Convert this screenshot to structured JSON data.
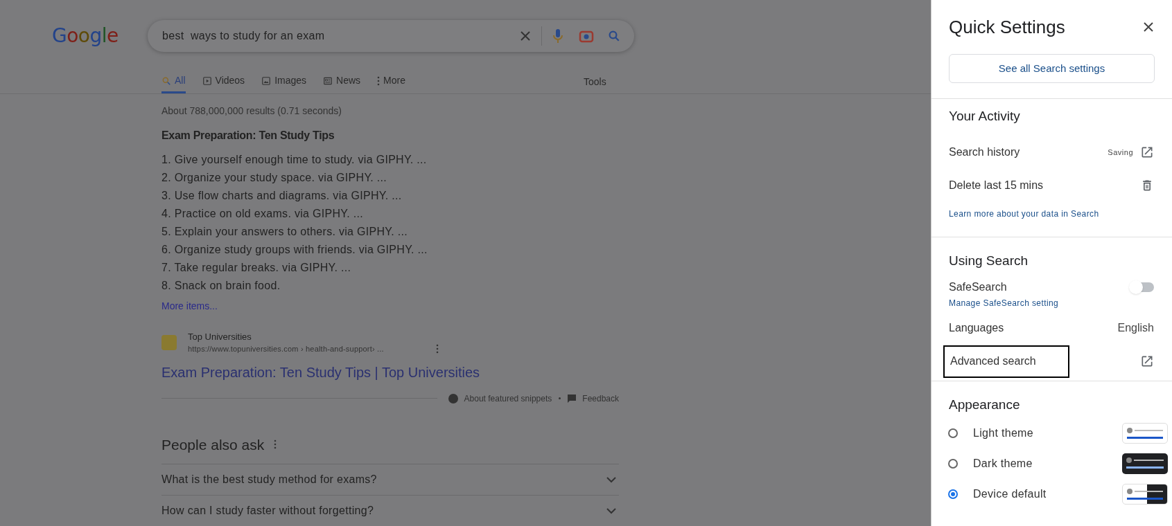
{
  "search_page": {
    "logo": "Google",
    "query": "best  ways to study for an exam",
    "tabs": [
      {
        "label": "All",
        "kind": "search",
        "selected": true
      },
      {
        "label": "Videos",
        "kind": "video",
        "selected": false
      },
      {
        "label": "Images",
        "kind": "image",
        "selected": false
      },
      {
        "label": "News",
        "kind": "news",
        "selected": false
      },
      {
        "label": "More",
        "kind": "dots",
        "selected": false
      }
    ],
    "tools": "Tools",
    "result_stats": "About 788,000,000 results (0.71 seconds)",
    "snippet_title": "Exam Preparation: Ten Study Tips",
    "snippet_items": [
      "1. Give yourself enough time to study. via GIPHY. ...",
      "2. Organize your study space. via GIPHY. ...",
      "3. Use flow charts and diagrams. via GIPHY. ...",
      "4. Practice on old exams. via GIPHY. ...",
      "5. Explain your answers to others. via GIPHY. ...",
      "6. Organize study groups with friends. via GIPHY. ...",
      "7. Take regular breaks. via GIPHY. ...",
      "8. Snack on brain food."
    ],
    "more_items": "More items...",
    "source_name": "Top Universities",
    "source_url": "https://www.topuniversities.com › health-and-support› ...",
    "result_title": "Exam Preparation: Ten Study Tips | Top Universities",
    "about_snippets": "About featured snippets",
    "feedback": "Feedback",
    "people_also_ask": "People also ask",
    "questions": [
      "What is the best study method for exams?",
      "How can I study faster without forgetting?"
    ]
  },
  "quick_settings": {
    "title": "Quick Settings",
    "see_all": "See all Search settings",
    "activity": {
      "heading": "Your Activity",
      "search_history": "Search history",
      "saving": "Saving",
      "delete_last": "Delete last 15 mins",
      "learn_more": "Learn more about your data in Search"
    },
    "using_search": {
      "heading": "Using Search",
      "safesearch": "SafeSearch",
      "safesearch_on": false,
      "manage_safesearch": "Manage SafeSearch setting",
      "languages": "Languages",
      "language_value": "English",
      "advanced_search": "Advanced search",
      "advanced_highlighted": true
    },
    "appearance": {
      "heading": "Appearance",
      "themes": [
        {
          "label": "Light theme",
          "kind": "light",
          "selected": false
        },
        {
          "label": "Dark theme",
          "kind": "dark",
          "selected": false
        },
        {
          "label": "Device default",
          "kind": "device",
          "selected": true
        }
      ]
    }
  }
}
